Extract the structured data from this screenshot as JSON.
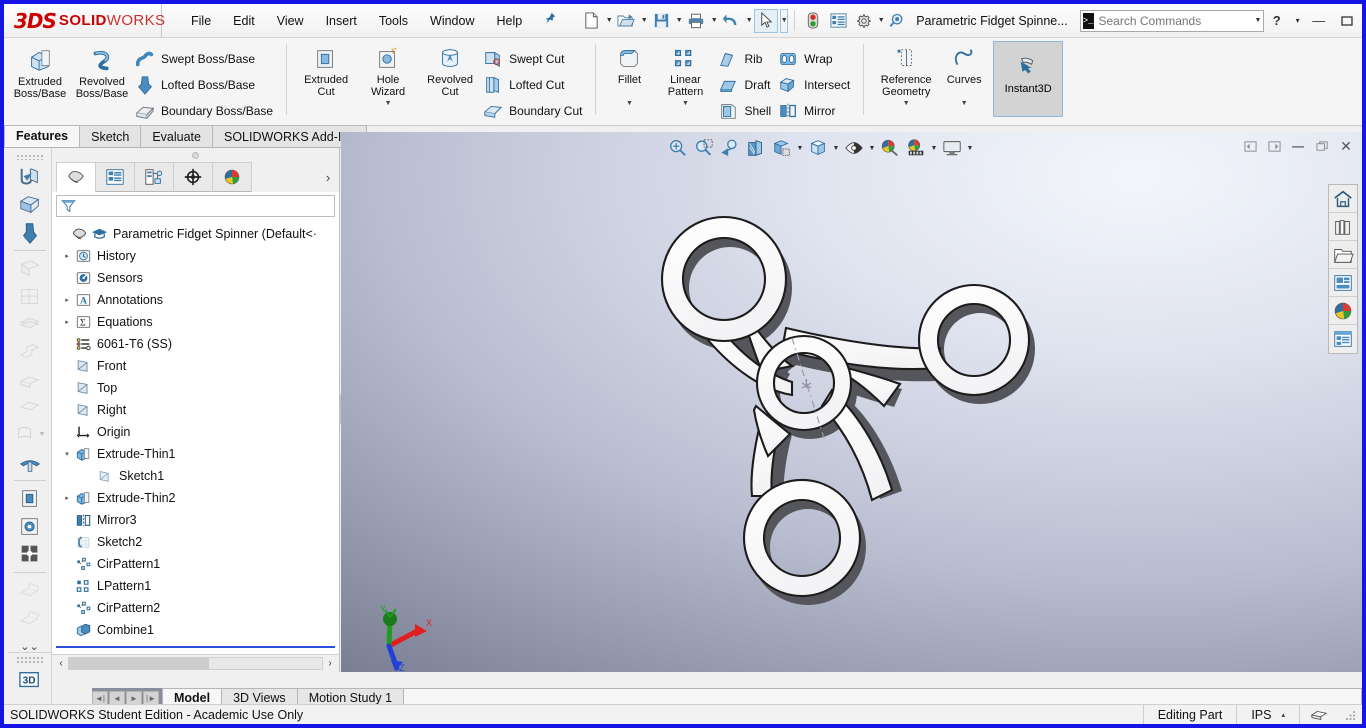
{
  "app": {
    "brand_3ds": "3DS",
    "brand_solid": "SOLID",
    "brand_works": "WORKS",
    "document_title": "Parametric Fidget Spinne...",
    "accent_blue": "#1414e6",
    "brand_red": "#cc0000"
  },
  "menu": {
    "items": [
      {
        "label": "File",
        "name": "menu-file"
      },
      {
        "label": "Edit",
        "name": "menu-edit"
      },
      {
        "label": "View",
        "name": "menu-view"
      },
      {
        "label": "Insert",
        "name": "menu-insert"
      },
      {
        "label": "Tools",
        "name": "menu-tools"
      },
      {
        "label": "Window",
        "name": "menu-window"
      },
      {
        "label": "Help",
        "name": "menu-help"
      }
    ],
    "pin_icon": "pushpin-icon"
  },
  "quick_access": {
    "buttons": [
      {
        "name": "new-document-icon",
        "tooltip": "New"
      },
      {
        "name": "open-document-icon",
        "tooltip": "Open"
      },
      {
        "name": "save-icon",
        "tooltip": "Save"
      },
      {
        "name": "print-icon",
        "tooltip": "Print"
      },
      {
        "name": "undo-icon",
        "tooltip": "Undo"
      },
      {
        "name": "select-cursor-icon",
        "tooltip": "Select"
      },
      {
        "name": "rebuild-icon",
        "tooltip": "Rebuild"
      },
      {
        "name": "options-list-icon",
        "tooltip": "File Properties"
      },
      {
        "name": "gear-icon",
        "tooltip": "Options"
      },
      {
        "name": "search-magnifier-icon",
        "tooltip": "Search"
      }
    ]
  },
  "search": {
    "placeholder": "Search Commands",
    "icon": "command-search-icon"
  },
  "window_controls": {
    "help": "?",
    "help_caret": "▾",
    "minimize": "—",
    "restore": "❐",
    "close": "✕"
  },
  "ribbon": {
    "groups": [
      {
        "name": "boss-base-group",
        "big": [
          {
            "label": "Extruded\nBoss/Base",
            "name": "extruded-boss-base-button",
            "line1": "Extruded",
            "line2": "Boss/Base",
            "icon": "extrude-boss-icon"
          },
          {
            "label": "Revolved Boss/Base",
            "name": "revolved-boss-base-button",
            "line1": "Revolved",
            "line2": "Boss/Base",
            "icon": "revolve-boss-icon"
          }
        ],
        "small": [
          {
            "label": "Swept Boss/Base",
            "name": "swept-boss-base-button",
            "icon": "swept-boss-icon"
          },
          {
            "label": "Lofted Boss/Base",
            "name": "lofted-boss-base-button",
            "icon": "lofted-boss-icon"
          },
          {
            "label": "Boundary Boss/Base",
            "name": "boundary-boss-base-button",
            "icon": "boundary-boss-icon"
          }
        ]
      },
      {
        "name": "cut-group",
        "big": [
          {
            "line1": "Extruded",
            "line2": "Cut",
            "name": "extruded-cut-button",
            "icon": "extrude-cut-icon"
          },
          {
            "line1": "Hole",
            "line2": "Wizard",
            "name": "hole-wizard-button",
            "icon": "hole-wizard-icon",
            "caret": true
          },
          {
            "line1": "Revolved",
            "line2": "Cut",
            "name": "revolved-cut-button",
            "icon": "revolve-cut-icon"
          }
        ],
        "small": [
          {
            "label": "Swept Cut",
            "name": "swept-cut-button",
            "icon": "swept-cut-icon"
          },
          {
            "label": "Lofted Cut",
            "name": "lofted-cut-button",
            "icon": "lofted-cut-icon"
          },
          {
            "label": "Boundary Cut",
            "name": "boundary-cut-button",
            "icon": "boundary-cut-icon"
          }
        ]
      },
      {
        "name": "features-group",
        "big": [
          {
            "line1": "Fillet",
            "line2": "",
            "name": "fillet-button",
            "icon": "fillet-icon",
            "caret": true
          },
          {
            "line1": "Linear",
            "line2": "Pattern",
            "name": "linear-pattern-button",
            "icon": "linear-pattern-icon",
            "caret": true
          }
        ],
        "small": [
          {
            "label": "Rib",
            "name": "rib-button",
            "icon": "rib-icon"
          },
          {
            "label": "Draft",
            "name": "draft-button",
            "icon": "draft-icon"
          },
          {
            "label": "Shell",
            "name": "shell-button",
            "icon": "shell-icon"
          }
        ],
        "small2": [
          {
            "label": "Wrap",
            "name": "wrap-button",
            "icon": "wrap-icon"
          },
          {
            "label": "Intersect",
            "name": "intersect-button",
            "icon": "intersect-icon"
          },
          {
            "label": "Mirror",
            "name": "mirror-button",
            "icon": "mirror-icon"
          }
        ]
      },
      {
        "name": "reference-group",
        "big": [
          {
            "line1": "Reference",
            "line2": "Geometry",
            "name": "reference-geometry-button",
            "icon": "reference-geometry-icon",
            "caret": true
          },
          {
            "line1": "Curves",
            "line2": "",
            "name": "curves-button",
            "icon": "curves-icon",
            "caret": true
          }
        ]
      }
    ],
    "instant3d": {
      "label": "Instant3D",
      "name": "instant3d-button",
      "icon": "instant3d-icon",
      "active": true
    }
  },
  "command_tabs": [
    {
      "label": "Features",
      "name": "tab-features",
      "active": true
    },
    {
      "label": "Sketch",
      "name": "tab-sketch",
      "active": false
    },
    {
      "label": "Evaluate",
      "name": "tab-evaluate",
      "active": false
    },
    {
      "label": "SOLIDWORKS Add-Ins",
      "name": "tab-solidworks-add-ins",
      "active": false
    }
  ],
  "left_toolbar": {
    "items": [
      {
        "name": "sheet-metal-base-flange-icon",
        "enabled": true
      },
      {
        "name": "convert-to-sheet-metal-icon",
        "enabled": true
      },
      {
        "name": "lofted-bend-icon",
        "enabled": true
      },
      {
        "name": "edge-flange-icon",
        "enabled": false
      },
      {
        "name": "miter-flange-icon",
        "enabled": false
      },
      {
        "name": "hem-icon",
        "enabled": false
      },
      {
        "name": "jog-icon",
        "enabled": false
      },
      {
        "name": "sketched-bend-icon",
        "enabled": false
      },
      {
        "name": "cross-break-icon",
        "enabled": false
      },
      {
        "name": "corner-icon",
        "enabled": false
      },
      {
        "name": "forming-tool-icon",
        "enabled": true
      },
      {
        "name": "extruded-cut-sheetmetal-icon",
        "enabled": true
      },
      {
        "name": "simple-hole-icon",
        "enabled": true
      },
      {
        "name": "vent-icon",
        "enabled": true
      },
      {
        "name": "unfold-icon",
        "enabled": false
      },
      {
        "name": "fold-icon",
        "enabled": false
      },
      {
        "name": "expand-chevrons-icon",
        "enabled": true
      }
    ],
    "tool3d_label": "3D",
    "tool3d_name": "3d-sketch-toolbar"
  },
  "feature_manager": {
    "tabs": [
      {
        "name": "featuremanager-design-tree-tab",
        "icon": "design-tree-icon",
        "active": true
      },
      {
        "name": "property-manager-tab",
        "icon": "property-manager-icon",
        "active": false
      },
      {
        "name": "configuration-manager-tab",
        "icon": "configuration-manager-icon",
        "active": false
      },
      {
        "name": "dimxpert-manager-tab",
        "icon": "dimxpert-icon",
        "active": false
      },
      {
        "name": "display-manager-tab",
        "icon": "display-manager-icon",
        "active": false
      }
    ],
    "more_tabs_icon": "chevron-right-icon",
    "filter": {
      "placeholder": "",
      "value": "",
      "icon": "filter-funnel-icon"
    },
    "tree": [
      {
        "label": "Parametric Fidget Spinner  (Default<·",
        "name": "tree-item-part-root",
        "icon": "part-icon",
        "indent": 0,
        "expander": "",
        "bold": false,
        "extra_icon": "graduation-cap-icon"
      },
      {
        "label": "History",
        "name": "tree-item-history",
        "icon": "history-icon",
        "indent": 1,
        "expander": "▸"
      },
      {
        "label": "Sensors",
        "name": "tree-item-sensors",
        "icon": "sensors-icon",
        "indent": 1,
        "expander": ""
      },
      {
        "label": "Annotations",
        "name": "tree-item-annotations",
        "icon": "annotations-icon",
        "indent": 1,
        "expander": "▸"
      },
      {
        "label": "Equations",
        "name": "tree-item-equations",
        "icon": "equations-icon",
        "indent": 1,
        "expander": "▸"
      },
      {
        "label": "6061-T6 (SS)",
        "name": "tree-item-material",
        "icon": "material-icon",
        "indent": 1,
        "expander": ""
      },
      {
        "label": "Front",
        "name": "tree-item-front-plane",
        "icon": "plane-icon",
        "indent": 1,
        "expander": ""
      },
      {
        "label": "Top",
        "name": "tree-item-top-plane",
        "icon": "plane-icon",
        "indent": 1,
        "expander": ""
      },
      {
        "label": "Right",
        "name": "tree-item-right-plane",
        "icon": "plane-icon",
        "indent": 1,
        "expander": ""
      },
      {
        "label": "Origin",
        "name": "tree-item-origin",
        "icon": "origin-icon",
        "indent": 1,
        "expander": ""
      },
      {
        "label": "Extrude-Thin1",
        "name": "tree-item-extrude-thin1",
        "icon": "extrude-feature-icon",
        "indent": 1,
        "expander": "▾"
      },
      {
        "label": "Sketch1",
        "name": "tree-item-sketch1",
        "icon": "sketch-icon",
        "indent": 2,
        "expander": ""
      },
      {
        "label": "Extrude-Thin2",
        "name": "tree-item-extrude-thin2",
        "icon": "extrude-feature-icon",
        "indent": 1,
        "expander": "▸"
      },
      {
        "label": "Mirror3",
        "name": "tree-item-mirror3",
        "icon": "mirror-feature-icon",
        "indent": 1,
        "expander": ""
      },
      {
        "label": "Sketch2",
        "name": "tree-item-sketch2",
        "icon": "sketch2-icon",
        "indent": 1,
        "expander": ""
      },
      {
        "label": "CirPattern1",
        "name": "tree-item-cirpattern1",
        "icon": "circular-pattern-icon",
        "indent": 1,
        "expander": ""
      },
      {
        "label": "LPattern1",
        "name": "tree-item-lpattern1",
        "icon": "linear-pattern-feature-icon",
        "indent": 1,
        "expander": ""
      },
      {
        "label": "CirPattern2",
        "name": "tree-item-cirpattern2",
        "icon": "circular-pattern-icon",
        "indent": 1,
        "expander": ""
      },
      {
        "label": "Combine1",
        "name": "tree-item-combine1",
        "icon": "combine-icon",
        "indent": 1,
        "expander": ""
      }
    ],
    "hscroll": {
      "left_arrow": "‹",
      "right_arrow": "›"
    }
  },
  "viewport": {
    "hud": [
      {
        "name": "zoom-to-fit-icon"
      },
      {
        "name": "zoom-to-area-icon"
      },
      {
        "name": "previous-view-icon"
      },
      {
        "name": "section-view-icon"
      },
      {
        "name": "view-orientation-icon",
        "caret": true
      },
      {
        "name": "display-style-icon",
        "caret": true
      },
      {
        "name": "hide-show-items-icon",
        "caret": true
      },
      {
        "name": "edit-appearance-icon"
      },
      {
        "name": "apply-scene-icon",
        "caret": true
      },
      {
        "name": "view-settings-icon",
        "caret": true
      }
    ],
    "window_controls": [
      {
        "name": "restore-left-icon",
        "glyph": "◂"
      },
      {
        "name": "restore-right-icon",
        "glyph": "▸"
      },
      {
        "name": "minimize-doc-icon",
        "glyph": "—"
      },
      {
        "name": "restore-doc-icon",
        "glyph": "❐"
      },
      {
        "name": "close-doc-icon",
        "glyph": "✕"
      }
    ],
    "triad": {
      "x_label": "X",
      "y_label": "Y",
      "z_label": "Z",
      "x_color": "#e02020",
      "y_color": "#1e9e1e",
      "z_color": "#2040d8"
    },
    "model_name": "parametric-fidget-spinner-model"
  },
  "right_toolbar": {
    "items": [
      {
        "name": "view-home-icon"
      },
      {
        "name": "appearances-library-icon"
      },
      {
        "name": "design-library-folder-icon"
      },
      {
        "name": "file-explorer-icon"
      },
      {
        "name": "appearances-sphere-icon"
      },
      {
        "name": "custom-properties-icon"
      }
    ]
  },
  "document_tabs": {
    "nav": [
      "❘◂",
      "◂",
      "▸",
      "▸❘"
    ],
    "tabs": [
      {
        "label": "Model",
        "name": "doc-tab-model",
        "active": true
      },
      {
        "label": "3D Views",
        "name": "doc-tab-3d-views",
        "active": false
      },
      {
        "label": "Motion Study 1",
        "name": "doc-tab-motion-study-1",
        "active": false
      }
    ]
  },
  "status_bar": {
    "left": "SOLIDWORKS Student Edition - Academic Use Only",
    "editing": "Editing Part",
    "units": "IPS",
    "units_caret": "▴",
    "overlay_icon": "overlay-icon",
    "resize_grip": "resize-grip-icon"
  }
}
